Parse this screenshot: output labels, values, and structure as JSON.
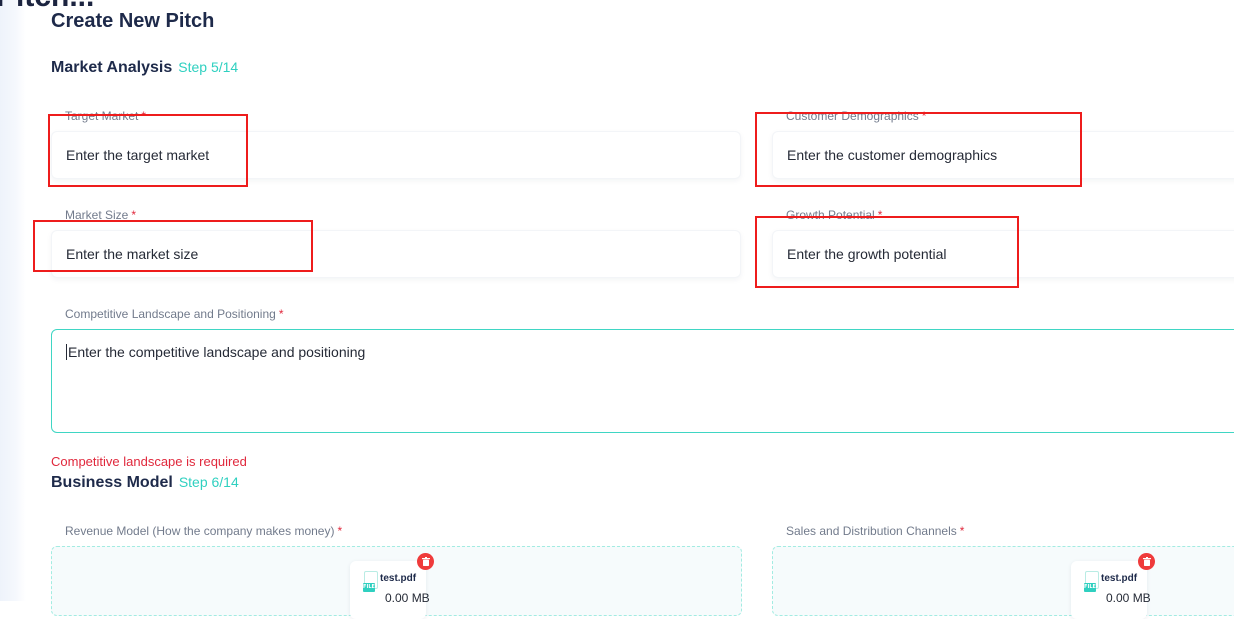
{
  "page": {
    "app_title_cutoff": "Pitch...",
    "title": "Create New Pitch"
  },
  "colors": {
    "accent": "#2fd0c0",
    "error": "#e0283c",
    "annotation_box": "#ee1c1c",
    "heading": "#1e2a4a"
  },
  "market_analysis": {
    "title": "Market Analysis",
    "step": "Step 5/14",
    "required_marker": "*",
    "target_market": {
      "label": "Target Market",
      "placeholder": "Enter the target market"
    },
    "customer_demographics": {
      "label": "Customer Demographics",
      "placeholder": "Enter the customer demographics"
    },
    "market_size": {
      "label": "Market Size",
      "placeholder": "Enter the market size"
    },
    "growth_potential": {
      "label": "Growth Potential",
      "placeholder": "Enter the growth potential"
    },
    "competitive_landscape": {
      "label": "Competitive Landscape and Positioning",
      "placeholder": "Enter the competitive landscape and positioning",
      "error": "Competitive landscape is required"
    }
  },
  "business_model": {
    "title": "Business Model",
    "step": "Step 6/14",
    "required_marker": "*",
    "revenue_model": {
      "label": "Revenue Model (How the company makes money)",
      "file": {
        "name": "test.pdf",
        "size": "0.00 MB",
        "badge": "FILE",
        "icon": "pdf-file-icon",
        "delete_icon": "trash-icon"
      }
    },
    "sales_channels": {
      "label": "Sales and Distribution Channels",
      "file": {
        "name": "test.pdf",
        "size": "0.00 MB",
        "badge": "FILE",
        "icon": "pdf-file-icon",
        "delete_icon": "trash-icon"
      }
    }
  }
}
